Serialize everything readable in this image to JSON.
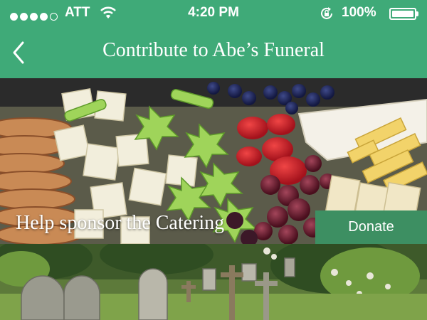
{
  "status_bar": {
    "carrier": "ATT",
    "time": "4:20 PM",
    "battery_percent": "100%",
    "signal_bars_filled": 4,
    "signal_bars_total": 5
  },
  "nav": {
    "title": "Contribute to Abe’s Funeral",
    "back_icon": "chevron-left-icon"
  },
  "card": {
    "caption": "Help sponsor the Catering",
    "donate_label": "Donate"
  },
  "colors": {
    "header": "#3faa78",
    "donate_button": "#3d8f62"
  }
}
